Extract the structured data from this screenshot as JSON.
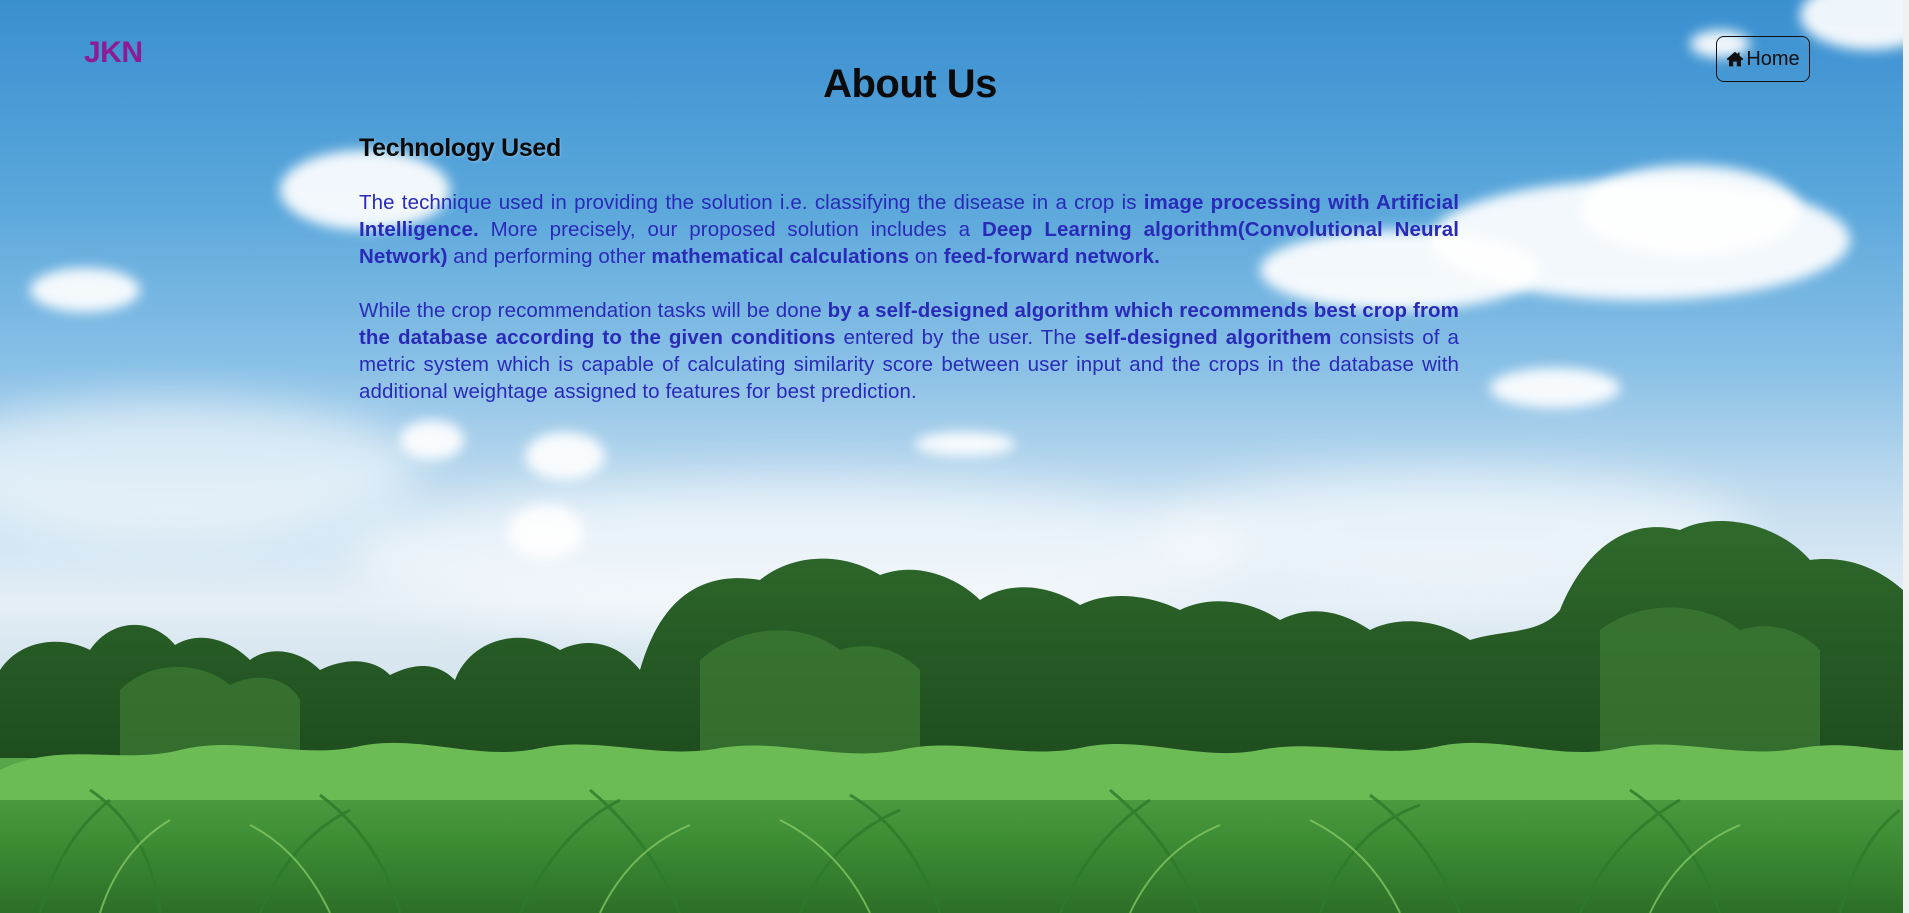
{
  "nav": {
    "brand": "JKN",
    "home_label": "Home",
    "home_icon": "home-icon"
  },
  "page": {
    "title": "About Us"
  },
  "section": {
    "heading": "Technology Used",
    "paragraphs": [
      {
        "segments": [
          {
            "text": "The technique used in providing the solution i.e. classifying the disease in a crop is ",
            "bold": false
          },
          {
            "text": "image processing with Artificial Intelligence.",
            "bold": true
          },
          {
            "text": " More precisely, our proposed solution includes a ",
            "bold": false
          },
          {
            "text": "Deep Learning algorithm(Convolutional Neural Network)",
            "bold": true
          },
          {
            "text": " and performing other ",
            "bold": false
          },
          {
            "text": "mathematical calculations",
            "bold": true
          },
          {
            "text": " on ",
            "bold": false
          },
          {
            "text": "feed-forward network.",
            "bold": true
          }
        ]
      },
      {
        "segments": [
          {
            "text": "While the crop recommendation tasks will be done ",
            "bold": false
          },
          {
            "text": "by a self-designed algorithm which recommends best crop from the database according to the given conditions",
            "bold": true
          },
          {
            "text": " entered by the user. The ",
            "bold": false
          },
          {
            "text": "self-designed algorithem",
            "bold": true
          },
          {
            "text": " consists of a metric system which is capable of calculating similarity score between user input and the crops in the database with additional weightage assigned to features for best prediction.",
            "bold": false
          }
        ]
      }
    ]
  },
  "colors": {
    "brand": "#8e1a94",
    "body_text": "#2a2ab8",
    "heading_text": "#0b0b0b",
    "sky_top": "#3a8fd0"
  }
}
